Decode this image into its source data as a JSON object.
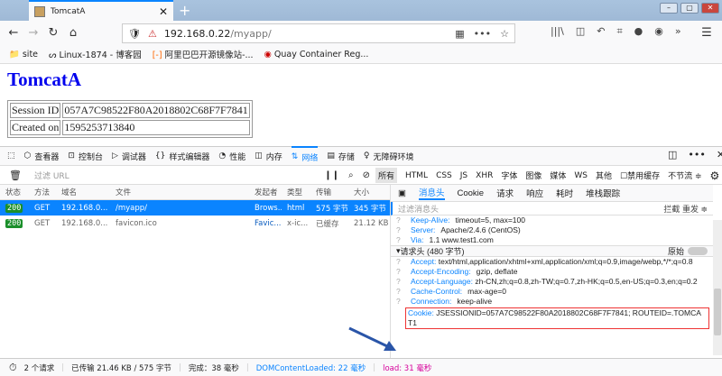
{
  "browser": {
    "tab_title": "TomcatA",
    "url_host": "192.168.0.22",
    "url_path": "/myapp/",
    "bookmarks": [
      "site",
      "Linux-1874 - 博客园",
      "阿里巴巴开源镜像站-...",
      "Quay Container Reg..."
    ]
  },
  "page": {
    "heading": "TomcatA",
    "rows": [
      {
        "label": "Session ID",
        "value": "057A7C98522F80A2018802C68F7F7841"
      },
      {
        "label": "Created on",
        "value": "1595253713840"
      }
    ]
  },
  "devtools": {
    "tabs": [
      "查看器",
      "控制台",
      "调试器",
      "样式编辑器",
      "性能",
      "内存",
      "网络",
      "存储",
      "无障碍环境"
    ],
    "filter_placeholder": "过滤 URL",
    "type_filters": [
      "所有",
      "HTML",
      "CSS",
      "JS",
      "XHR",
      "字体",
      "图像",
      "媒体",
      "WS",
      "其他"
    ],
    "disable_cache": "禁用缓存",
    "throttle": "不节流 ≑",
    "columns": [
      "状态",
      "方法",
      "域名",
      "文件",
      "发起者",
      "类型",
      "传输",
      "大小"
    ],
    "requests": [
      {
        "status": "200",
        "method": "GET",
        "domain": "192.168.0...",
        "file": "/myapp/",
        "initiator": "Brows...",
        "type": "html",
        "transferred": "575 字节",
        "size": "345 字节"
      },
      {
        "status": "200",
        "method": "GET",
        "domain": "192.168.0...",
        "file": "favicon.ico",
        "initiator": "Favic...",
        "type": "x-ic...",
        "transferred": "已缓存",
        "size": "21.12 KB"
      }
    ],
    "detail_tabs": [
      "消息头",
      "Cookie",
      "请求",
      "响应",
      "耗时",
      "堆栈跟踪"
    ],
    "header_filter_placeholder": "过滤消息头",
    "block": "拦截",
    "resend": "重发 ≑",
    "response_headers": [
      {
        "k": "Keep-Alive:",
        "v": "timeout=5, max=100"
      },
      {
        "k": "Server:",
        "v": "Apache/2.4.6 (CentOS)"
      },
      {
        "k": "Via:",
        "v": "1.1 www.test1.com"
      }
    ],
    "request_section": "请求头 (480 字节)",
    "raw": "原始",
    "request_headers": [
      {
        "k": "Accept:",
        "v": "text/html,application/xhtml+xml,application/xml;q=0.9,image/webp,*/*;q=0.8"
      },
      {
        "k": "Accept-Encoding:",
        "v": "gzip, deflate"
      },
      {
        "k": "Accept-Language:",
        "v": "zh-CN,zh;q=0.8,zh-TW;q=0.7,zh-HK;q=0.5,en-US;q=0.3,en;q=0.2"
      },
      {
        "k": "Cache-Control:",
        "v": "max-age=0"
      },
      {
        "k": "Connection:",
        "v": "keep-alive"
      }
    ],
    "cookie": {
      "k": "Cookie:",
      "v": "JSESSIONID=057A7C98522F80A2018802C68F7F7841; ROUTEID=.TOMCAT1"
    },
    "status": {
      "requests": "2 个请求",
      "transferred": "已传输 21.46 KB / 575 字节",
      "finish": "完成：38 毫秒",
      "dcl": "DOMContentLoaded: 22 毫秒",
      "load": "load: 31 毫秒"
    }
  }
}
